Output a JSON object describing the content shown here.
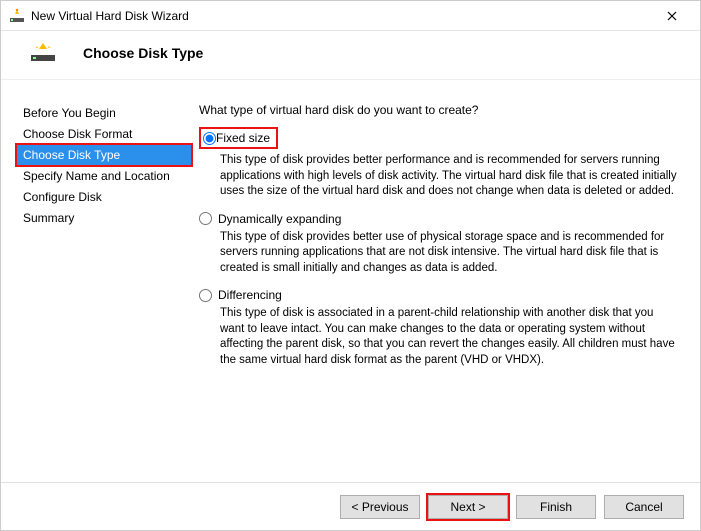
{
  "window": {
    "title": "New Virtual Hard Disk Wizard"
  },
  "header": {
    "title": "Choose Disk Type"
  },
  "sidebar": {
    "steps": [
      {
        "label": "Before You Begin",
        "selected": false
      },
      {
        "label": "Choose Disk Format",
        "selected": false
      },
      {
        "label": "Choose Disk Type",
        "selected": true
      },
      {
        "label": "Specify Name and Location",
        "selected": false
      },
      {
        "label": "Configure Disk",
        "selected": false
      },
      {
        "label": "Summary",
        "selected": false
      }
    ]
  },
  "content": {
    "prompt": "What type of virtual hard disk do you want to create?",
    "options": [
      {
        "id": "fixed",
        "label": "Fixed size",
        "selected": true,
        "description": "This type of disk provides better performance and is recommended for servers running applications with high levels of disk activity. The virtual hard disk file that is created initially uses the size of the virtual hard disk and does not change when data is deleted or added."
      },
      {
        "id": "dynamic",
        "label": "Dynamically expanding",
        "selected": false,
        "description": "This type of disk provides better use of physical storage space and is recommended for servers running applications that are not disk intensive. The virtual hard disk file that is created is small initially and changes as data is added."
      },
      {
        "id": "differencing",
        "label": "Differencing",
        "selected": false,
        "description": "This type of disk is associated in a parent-child relationship with another disk that you want to leave intact. You can make changes to the data or operating system without affecting the parent disk, so that you can revert the changes easily. All children must have the same virtual hard disk format as the parent (VHD or VHDX)."
      }
    ]
  },
  "footer": {
    "previous": "< Previous",
    "next": "Next >",
    "finish": "Finish",
    "cancel": "Cancel"
  },
  "highlights": {
    "step_index": 2,
    "option_id": "fixed",
    "button": "next"
  }
}
